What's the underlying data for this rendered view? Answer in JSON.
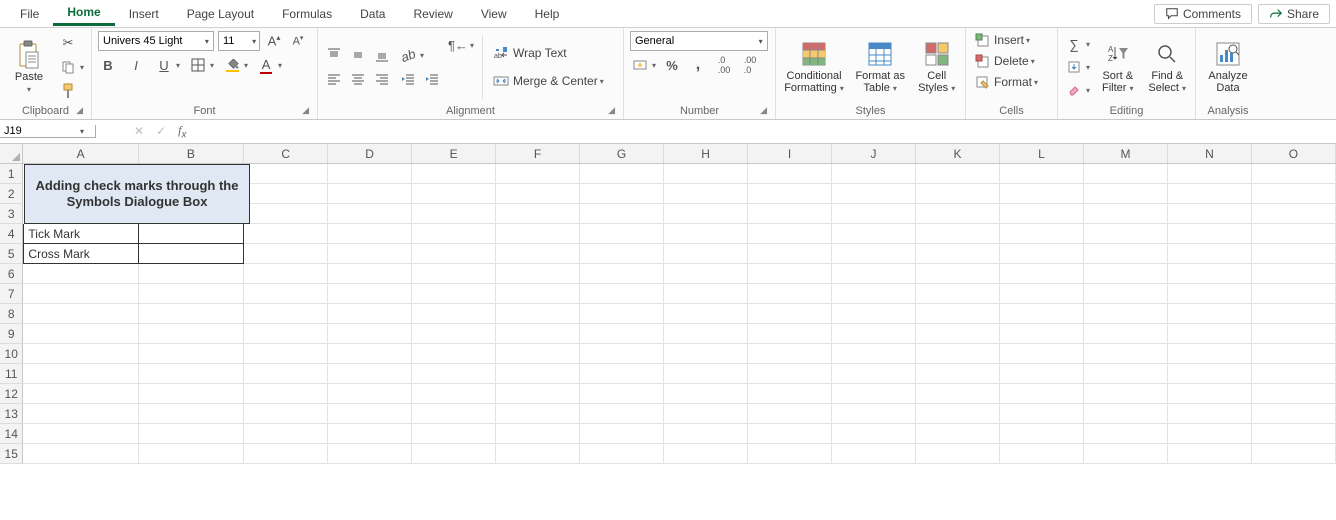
{
  "tabs": {
    "items": [
      "File",
      "Home",
      "Insert",
      "Page Layout",
      "Formulas",
      "Data",
      "Review",
      "View",
      "Help"
    ],
    "active_index": 1,
    "comments": "Comments",
    "share": "Share"
  },
  "ribbon": {
    "clipboard": {
      "paste": "Paste",
      "label": "Clipboard"
    },
    "font": {
      "name": "Univers 45 Light",
      "size": "11",
      "label": "Font"
    },
    "alignment": {
      "wrap": "Wrap Text",
      "merge": "Merge & Center",
      "label": "Alignment"
    },
    "number": {
      "format": "General",
      "label": "Number"
    },
    "styles": {
      "cond": "Conditional Formatting",
      "fat": "Format as Table",
      "cell": "Cell Styles",
      "label": "Styles"
    },
    "cells": {
      "insert": "Insert",
      "delete": "Delete",
      "format": "Format",
      "label": "Cells"
    },
    "editing": {
      "sort": "Sort & Filter",
      "find": "Find & Select",
      "label": "Editing"
    },
    "analysis": {
      "analyze": "Analyze Data",
      "label": "Analysis"
    }
  },
  "formula_bar": {
    "name_box": "J19",
    "cell_value": ""
  },
  "grid": {
    "columns": [
      "A",
      "B",
      "C",
      "D",
      "E",
      "F",
      "G",
      "H",
      "I",
      "J",
      "K",
      "L",
      "M",
      "N",
      "O"
    ],
    "row_count": 15,
    "merged_header": "Adding check marks through the Symbols Dialogue Box",
    "a4": "Tick Mark",
    "a5": "Cross Mark"
  }
}
